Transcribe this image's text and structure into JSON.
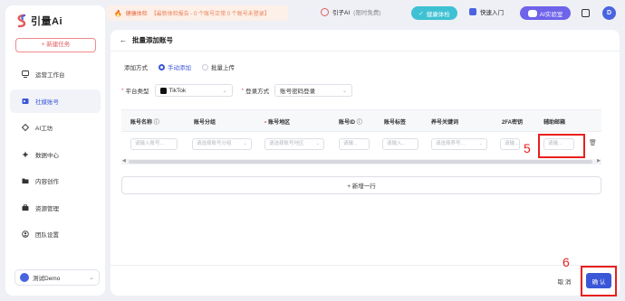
{
  "brand": {
    "name": "引量Ai"
  },
  "sidebar": {
    "new_task": "+ 新建任务",
    "items": [
      {
        "label": "运营工作台",
        "icon": "dashboard-icon"
      },
      {
        "label": "社媒账号",
        "icon": "account-icon",
        "active": true
      },
      {
        "label": "AI工坊",
        "icon": "ai-workshop-icon"
      },
      {
        "label": "数据中心",
        "icon": "data-icon"
      },
      {
        "label": "内容创作",
        "icon": "content-icon"
      },
      {
        "label": "资源管理",
        "icon": "resource-icon"
      },
      {
        "label": "团队设置",
        "icon": "team-icon"
      }
    ],
    "user": "测试Demo"
  },
  "topbar": {
    "notice_title": "健康体检",
    "notice_detail": "【最新体检报告 - 0 个账号正常 0 个账号未登录】",
    "yinzi": "引子AI",
    "yinzi_tag": "(限时免费)",
    "health_check": "健康体检",
    "quick_start": "快速入门",
    "ai_lab": "AI实验室",
    "avatar_letter": "D"
  },
  "page": {
    "title": "批量添加账号",
    "add_method_label": "添加方式",
    "add_methods": [
      "手动添加",
      "批量上传"
    ],
    "platform_label": "平台类型",
    "platform_value": "TikTok",
    "login_label": "登录方式",
    "login_value": "账号密码登录"
  },
  "table": {
    "headers": [
      "账号名称",
      "账号分组",
      "账号地区",
      "账号ID",
      "账号标签",
      "养号关键词",
      "2FA密钥",
      "辅助邮箱"
    ],
    "placeholders": [
      "请输入账号...",
      "请选择账号分组",
      "请选择账号地区",
      "请输...",
      "请输入...",
      "请选择养号...",
      "请输...",
      "请输..."
    ],
    "add_row": "+ 新增一行"
  },
  "footer": {
    "cancel": "取 消",
    "confirm": "确 认"
  },
  "annotations": {
    "step5": "5",
    "step6": "6",
    "color": "#e8201c"
  },
  "colors": {
    "primary": "#3a57d6",
    "accent_red": "#e25c5c",
    "teal": "#3ec1d3",
    "purple": "#6e63e9"
  }
}
